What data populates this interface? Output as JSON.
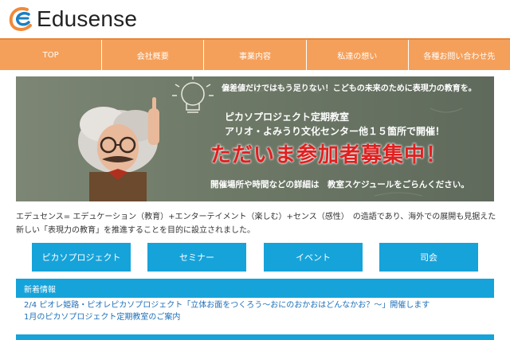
{
  "logo": {
    "text": "Edusense"
  },
  "nav": {
    "items": [
      {
        "label": "TOP"
      },
      {
        "label": "会社概要"
      },
      {
        "label": "事業内容"
      },
      {
        "label": "私達の想い"
      },
      {
        "label": "各種お問い合わせ先"
      }
    ]
  },
  "banner": {
    "line1": "偏差値だけではもう足りない！こどもの未来のために表現力の教育を。",
    "line2": "ピカソプロジェクト定期教室",
    "line3": "アリオ・よみうり文化センター他１５箇所で開催！",
    "headline": "ただいま参加者募集中！",
    "note": "開催場所や時間などの詳細は　教室スケジュールをごらんください。"
  },
  "intro": {
    "text": "エデュセンス= エデュケーション（教育）+エンターテイメント（楽しむ）+センス（感性）　の造語であり、海外での展開も見据えた新しい「表現力の教育」を推進することを目的に設立されました。"
  },
  "buttons": [
    {
      "label": "ピカソプロジェクト"
    },
    {
      "label": "セミナー"
    },
    {
      "label": "イベント"
    },
    {
      "label": "司会"
    }
  ],
  "news": {
    "title": "新着情報",
    "items": [
      {
        "text": "2/4 ピオレ姫路・ピオレピカソプロジェクト「立体お面をつくろう～おにのおかおはどんなかお？～」開催します"
      },
      {
        "text": "1月のピカソプロジェクト定期教室のご案内"
      }
    ]
  },
  "colors": {
    "nav": "#f5a05a",
    "accent_blue": "#16a3da",
    "headline_red": "#e02020"
  }
}
